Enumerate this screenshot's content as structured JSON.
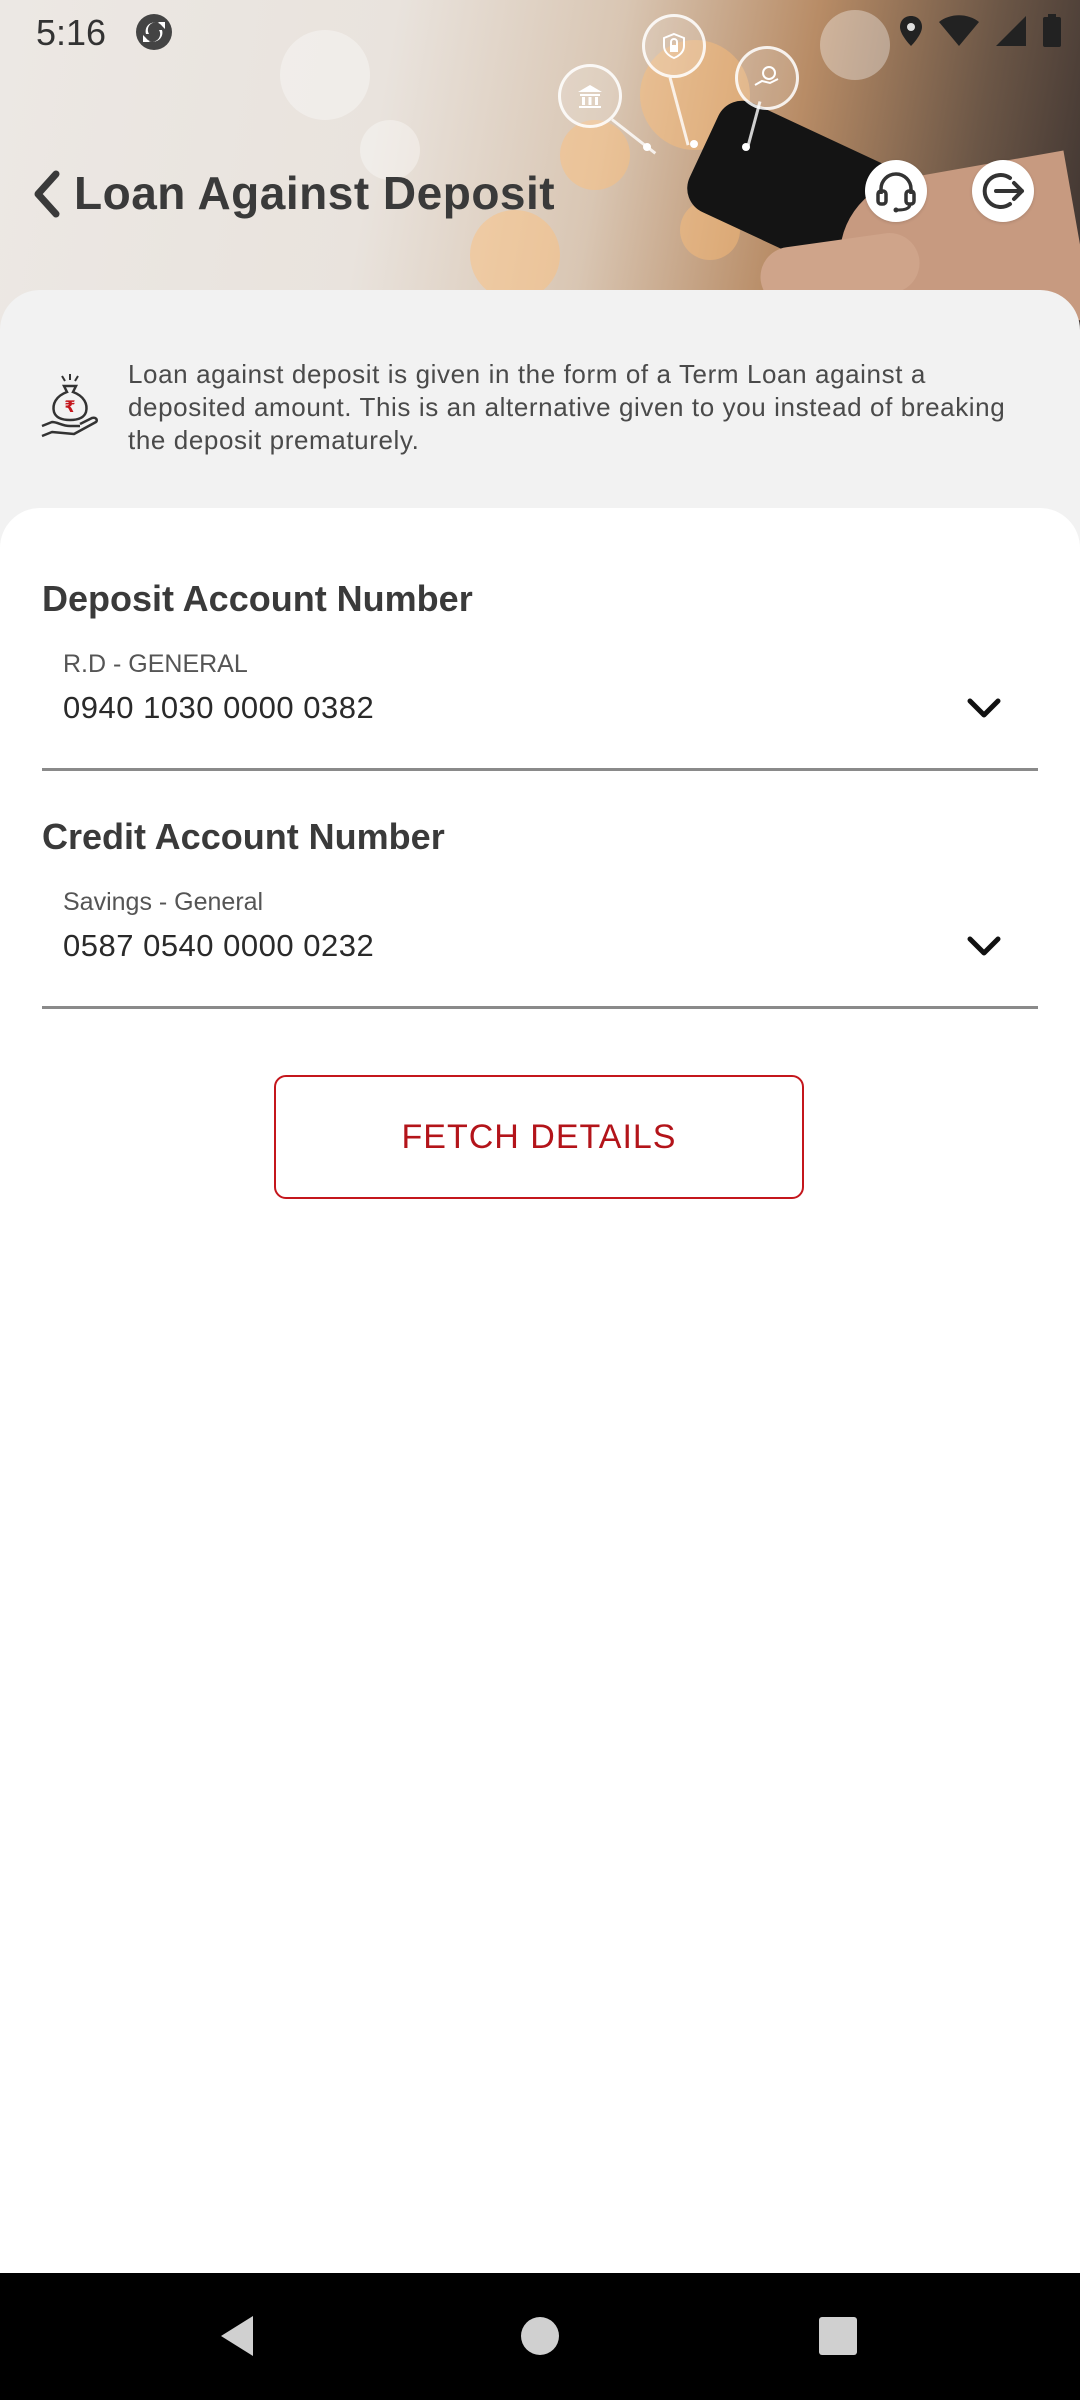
{
  "status_bar": {
    "time": "5:16",
    "icons": [
      "sync-icon",
      "location-icon",
      "wifi-icon",
      "signal-icon",
      "battery-icon"
    ]
  },
  "header": {
    "title": "Loan Against Deposit",
    "back_icon": "chevron-left-icon",
    "actions": [
      "headset-support-icon",
      "logout-icon"
    ]
  },
  "info": {
    "icon": "money-bag-hand-icon",
    "text": "Loan against deposit is given in the form of a Term Loan against a deposited amount. This is an alternative given to you instead of breaking the deposit prematurely."
  },
  "form": {
    "deposit": {
      "label": "Deposit Account Number",
      "account_type": "R.D - GENERAL",
      "account_number": "0940 1030 0000 0382"
    },
    "credit": {
      "label": "Credit Account Number",
      "account_type": "Savings - General",
      "account_number": "0587 0540 0000 0232"
    },
    "fetch_button": "FETCH DETAILS"
  },
  "colors": {
    "accent": "#c4161c",
    "title_text": "#3a3a3a",
    "panel_bg": "#f2f2f2"
  },
  "nav_bar": {
    "buttons": [
      "back-triangle-icon",
      "home-circle-icon",
      "recents-square-icon"
    ]
  }
}
